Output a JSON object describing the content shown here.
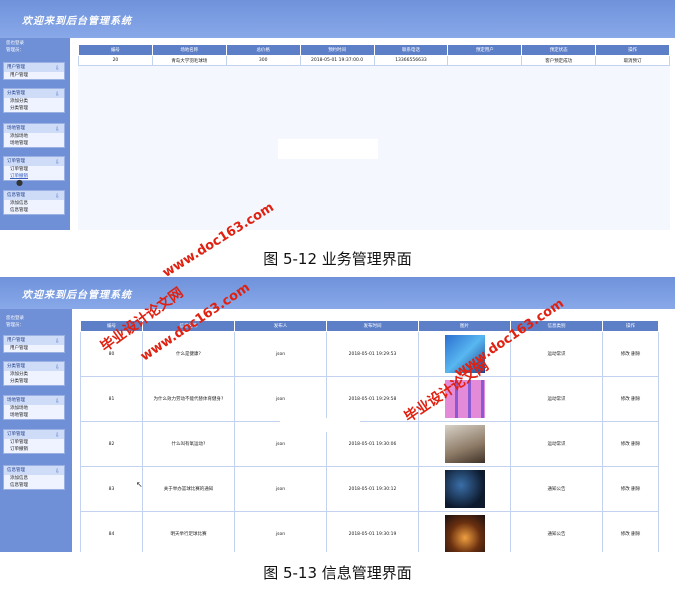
{
  "header_title": "欢迎来到后台管理系统",
  "sidebar": {
    "login_line1": "您也登录",
    "login_line2": "管理员：",
    "groups": [
      {
        "title": "用户管理",
        "items": [
          "用户管理"
        ]
      },
      {
        "title": "分类管理",
        "items": [
          "添加分类",
          "分类管理"
        ]
      },
      {
        "title": "场地管理",
        "items": [
          "添加场地",
          "场地管理"
        ]
      },
      {
        "title": "订单管理",
        "items": [
          "订单管理",
          "订单撤销"
        ]
      },
      {
        "title": "信息管理",
        "items": [
          "添加信息",
          "信息管理"
        ]
      }
    ]
  },
  "screen1": {
    "headers": [
      "编号",
      "场地名称",
      "总价格",
      "预约时间",
      "联系电话",
      "预定用户",
      "预定状态",
      "操作"
    ],
    "row": [
      "20",
      "青岛大学羽毛球场",
      "300",
      "2018-05-01 19:37:00.0",
      "13366556633",
      "",
      "客户预定成功",
      "取消预订"
    ],
    "caption": "图 5-12   业务管理界面"
  },
  "screen2": {
    "headers": [
      "编号",
      "信息名称",
      "发布人",
      "发布时间",
      "图片",
      "信息类别",
      "操作"
    ],
    "rows": [
      [
        "80",
        "什么是健康?",
        "json",
        "2018-05-01 19:29:53",
        "运动常识",
        "修改  删除"
      ],
      [
        "81",
        "为什么效力劳动不能代替体育健身?",
        "json",
        "2018-05-01 19:29:58",
        "运动常识",
        "修改  删除"
      ],
      [
        "82",
        "什么叫有氧运动?",
        "json",
        "2018-05-01 19:30:06",
        "运动常识",
        "修改  删除"
      ],
      [
        "83",
        "关于举办篮球比赛的通知",
        "json",
        "2018-05-01 19:30:12",
        "通知公告",
        "修改  删除"
      ],
      [
        "84",
        "明天举行足球比赛",
        "json",
        "2018-05-01 19:30:19",
        "通知公告",
        "修改  删除"
      ]
    ],
    "caption": "图 5-13  信息管理界面"
  },
  "watermark": {
    "site": "www.doc163.com",
    "label": "毕业设计论文网"
  },
  "colors": {
    "header": "#7698df",
    "sidebar": "#6f8fd6",
    "table_head": "#5d7fc8",
    "watermark": "#e02010"
  }
}
